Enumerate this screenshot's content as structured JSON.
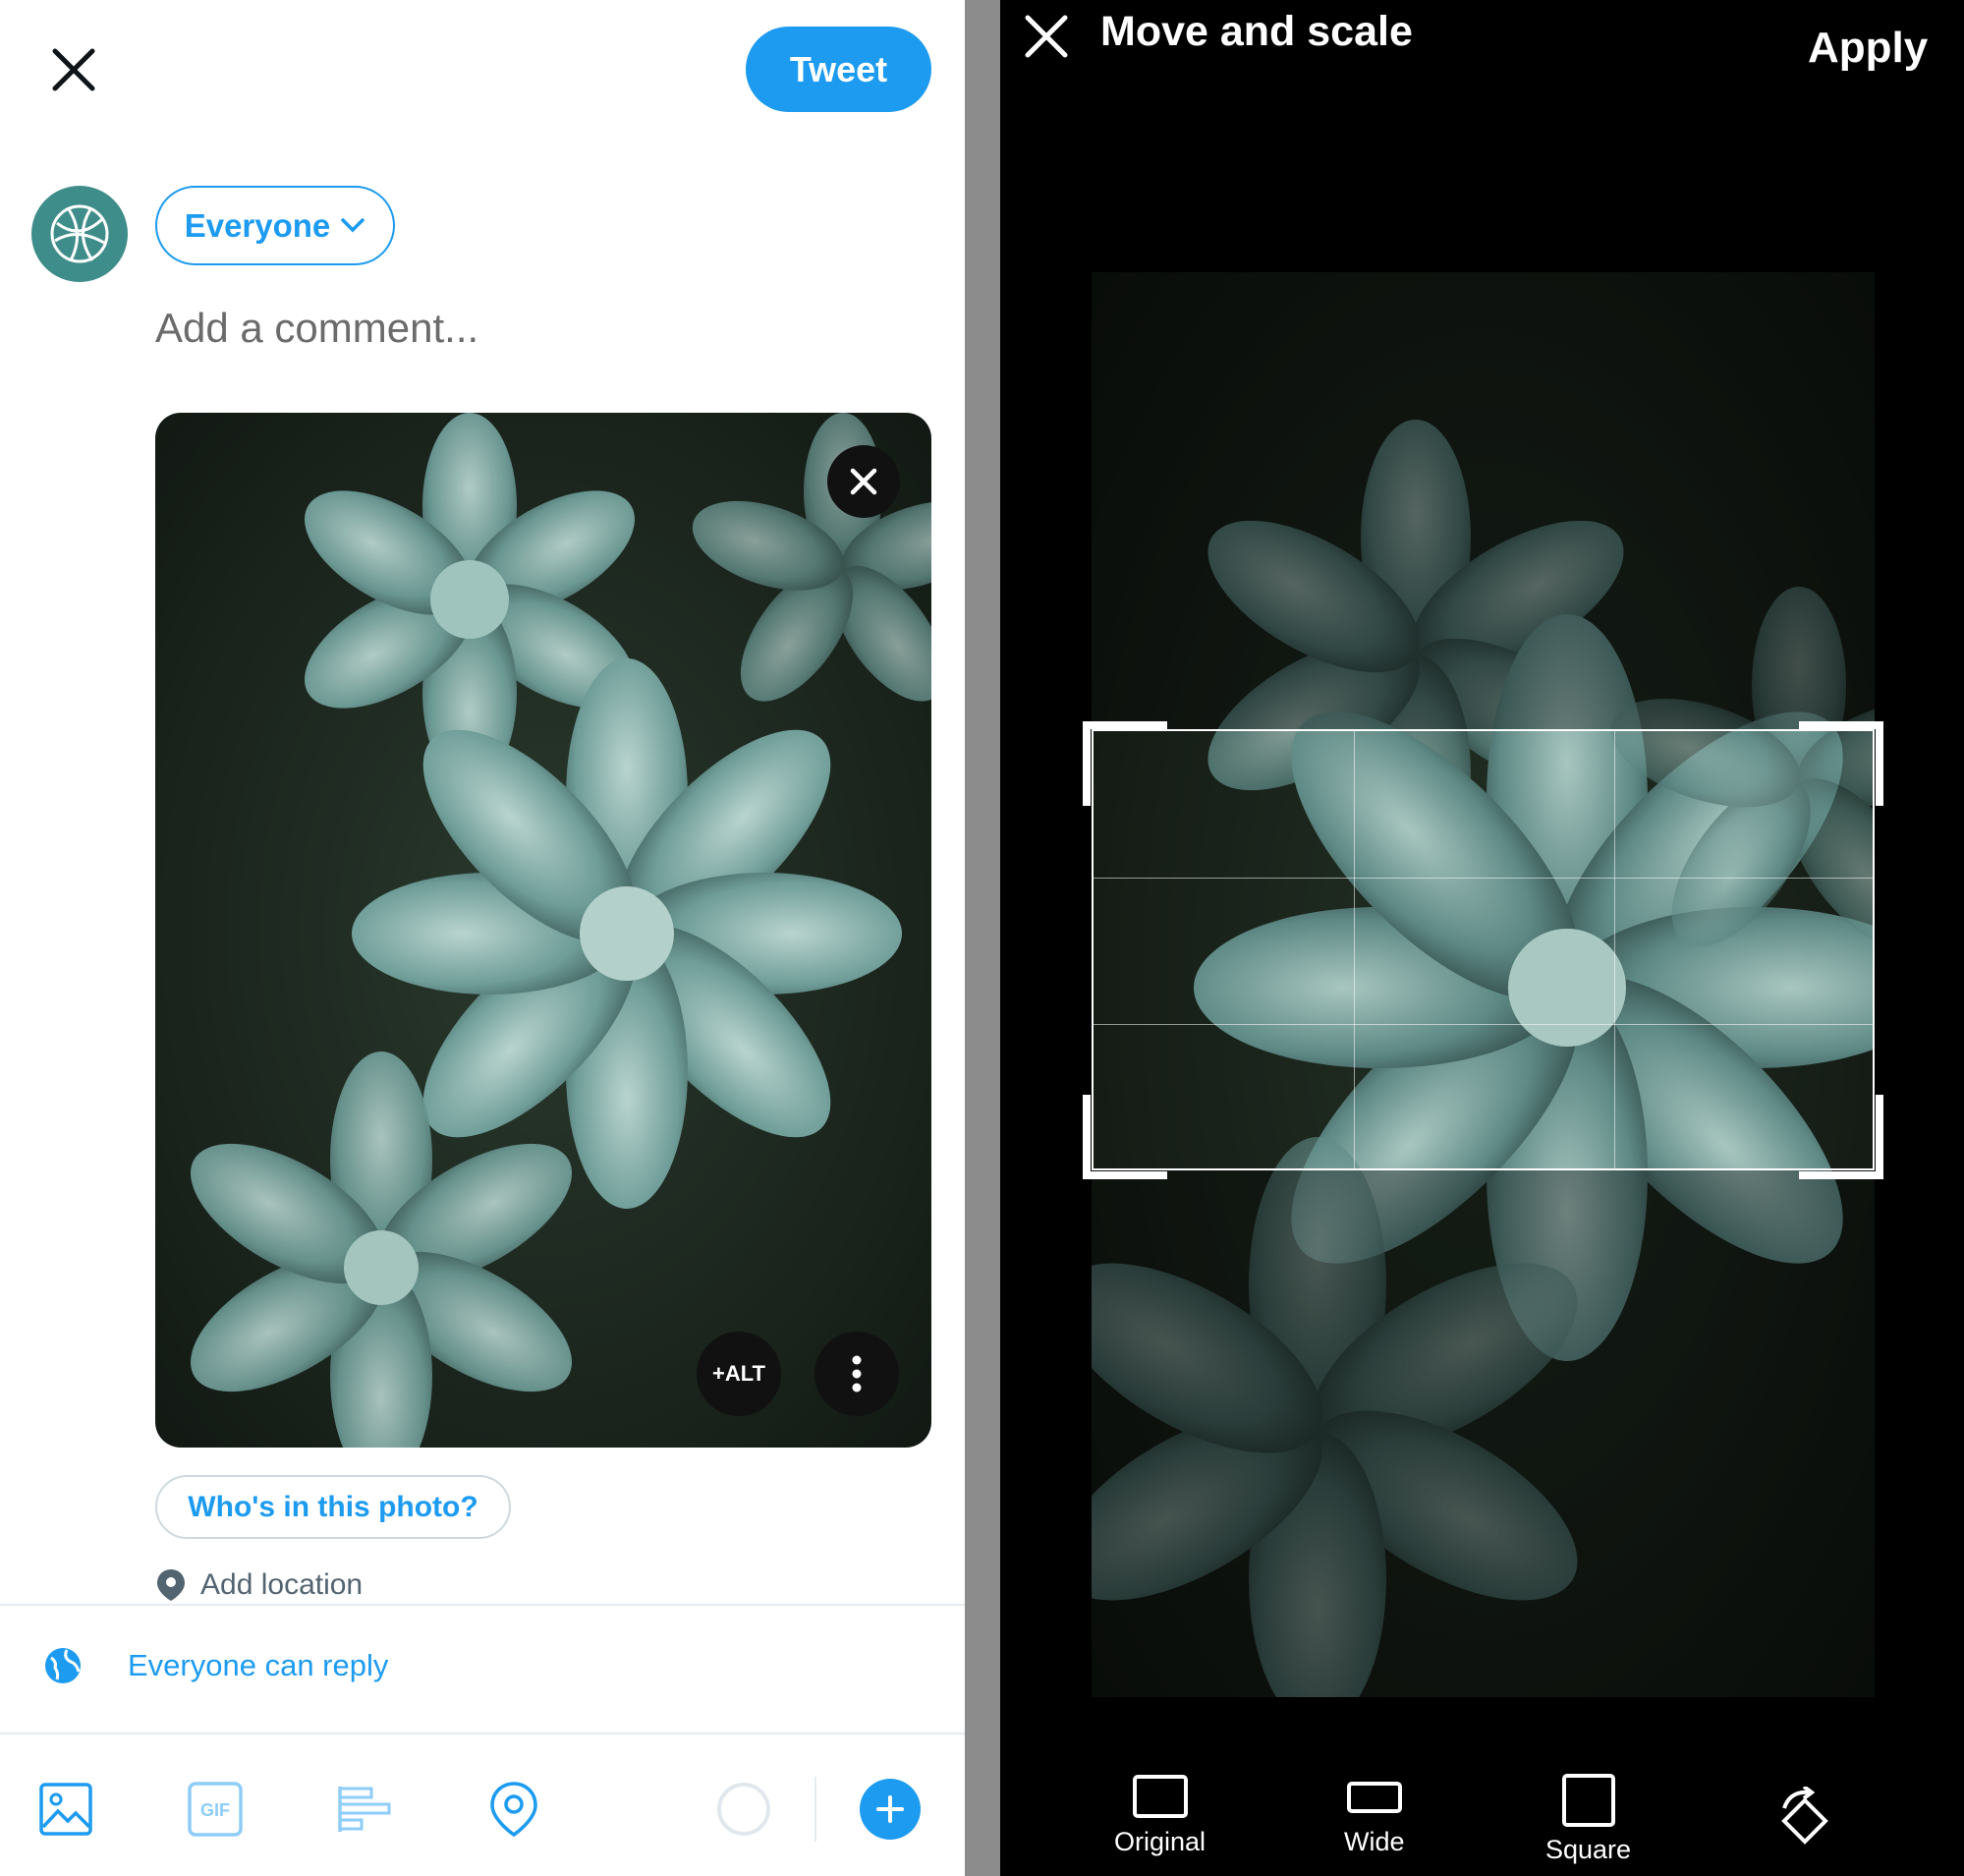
{
  "compose": {
    "tweet_label": "Tweet",
    "audience_label": "Everyone",
    "comment_placeholder": "Add a comment...",
    "alt_label": "+ALT",
    "tag_label": "Who's in this photo?",
    "location_label": "Add location",
    "reply_setting_label": "Everyone can reply",
    "toolbar": [
      "image-icon",
      "gif-icon",
      "poll-icon",
      "location-icon"
    ],
    "gif_label": "GIF",
    "accent_color": "#1d9bf0"
  },
  "editor": {
    "title": "Move and scale",
    "apply_label": "Apply",
    "aspect_options": [
      {
        "label": "Original",
        "icon": "ratio-original-icon"
      },
      {
        "label": "Wide",
        "icon": "ratio-wide-icon",
        "selected": true
      },
      {
        "label": "Square",
        "icon": "ratio-square-icon"
      }
    ]
  }
}
